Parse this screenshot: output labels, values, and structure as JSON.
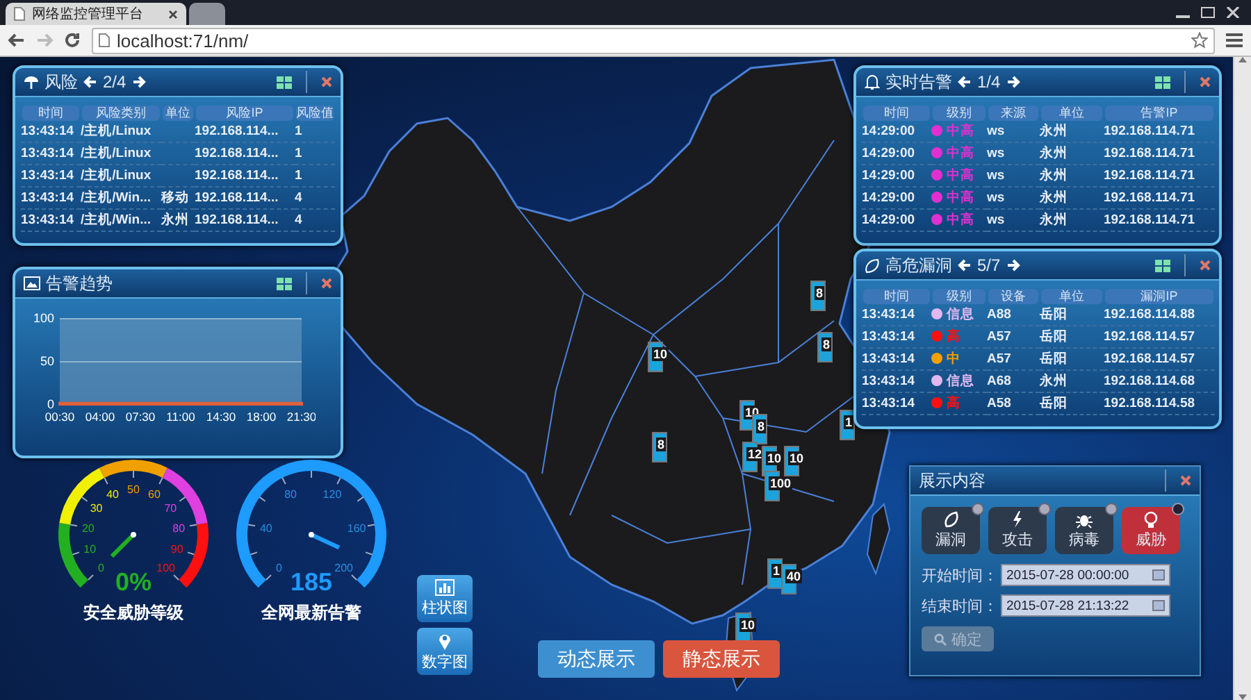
{
  "browser": {
    "tabs": [
      {
        "title": "网络监控管理平台",
        "selected": true
      },
      {
        "selected": false
      }
    ],
    "url": "localhost:71/nm/"
  },
  "risk_panel": {
    "title": "风险",
    "page": "2/4",
    "columns": [
      "时间",
      "风险类别",
      "单位",
      "风险IP",
      "风险值"
    ],
    "rows": [
      {
        "time": "13:43:14",
        "category": "/主机/Linux",
        "ip": "192.168.114...",
        "value": "1"
      },
      {
        "time": "13:43:14",
        "category": "/主机/Linux",
        "ip": "192.168.114...",
        "value": "1"
      },
      {
        "time": "13:43:14",
        "category": "/主机/Linux",
        "ip": "192.168.114...",
        "value": "1"
      },
      {
        "time": "13:43:14",
        "category": "/主机/Win...",
        "unit": "移动",
        "ip": "192.168.114...",
        "value": "4"
      },
      {
        "time": "13:43:14",
        "category": "/主机/Win...",
        "unit": "永州",
        "ip": "192.168.114...",
        "value": "4"
      }
    ]
  },
  "trend_panel": {
    "title": "告警趋势",
    "chart_data": {
      "type": "area",
      "categories": [
        "00:30",
        "04:00",
        "07:30",
        "11:00",
        "14:30",
        "18:00",
        "21:30"
      ],
      "series": [
        {
          "color": "#e0603c",
          "values": [
            1,
            1,
            1,
            1,
            1,
            1,
            1
          ]
        }
      ],
      "ylim": [
        0,
        100
      ],
      "yticks": [
        0,
        50,
        100
      ]
    }
  },
  "alert_panel": {
    "title": "实时告警",
    "page": "1/4",
    "columns": [
      "时间",
      "级别",
      "来源",
      "单位",
      "告警IP"
    ],
    "rows": [
      {
        "time": "14:29:00",
        "level": "中高",
        "color": "#e030d0",
        "source": "ws",
        "unit": "永州",
        "ip": "192.168.114.71"
      },
      {
        "time": "14:29:00",
        "level": "中高",
        "color": "#e030d0",
        "source": "ws",
        "unit": "永州",
        "ip": "192.168.114.71"
      },
      {
        "time": "14:29:00",
        "level": "中高",
        "color": "#e030d0",
        "source": "ws",
        "unit": "永州",
        "ip": "192.168.114.71"
      },
      {
        "time": "14:29:00",
        "level": "中高",
        "color": "#e030d0",
        "source": "ws",
        "unit": "永州",
        "ip": "192.168.114.71"
      },
      {
        "time": "14:29:00",
        "level": "中高",
        "color": "#e030d0",
        "source": "ws",
        "unit": "永州",
        "ip": "192.168.114.71"
      }
    ]
  },
  "vuln_panel": {
    "title": "高危漏洞",
    "page": "5/7",
    "columns": [
      "时间",
      "级别",
      "设备",
      "单位",
      "漏洞IP"
    ],
    "rows": [
      {
        "time": "13:43:14",
        "level": "信息",
        "color": "#e0b8f0",
        "device": "A88",
        "unit": "岳阳",
        "ip": "192.168.114.88"
      },
      {
        "time": "13:43:14",
        "level": "高",
        "color": "#ff1010",
        "device": "A57",
        "unit": "岳阳",
        "ip": "192.168.114.57"
      },
      {
        "time": "13:43:14",
        "level": "中",
        "color": "#f0a000",
        "device": "A57",
        "unit": "岳阳",
        "ip": "192.168.114.57"
      },
      {
        "time": "13:43:14",
        "level": "信息",
        "color": "#e0b8f0",
        "device": "A68",
        "unit": "永州",
        "ip": "192.168.114.68"
      },
      {
        "time": "13:43:14",
        "level": "高",
        "color": "#ff1010",
        "device": "A58",
        "unit": "岳阳",
        "ip": "192.168.114.58"
      }
    ]
  },
  "map_markers": [
    {
      "value": "8"
    },
    {
      "value": "10"
    },
    {
      "value": "8"
    },
    {
      "value": "1"
    },
    {
      "value": "10"
    },
    {
      "value": "8"
    },
    {
      "value": "8"
    },
    {
      "value": "12"
    },
    {
      "value": "10"
    },
    {
      "value": "10"
    },
    {
      "value": "100"
    },
    {
      "value": "1"
    },
    {
      "value": "40"
    },
    {
      "value": "10"
    }
  ],
  "gauges": [
    {
      "kind": "threat",
      "label": "安全威胁等级",
      "reading": "0%",
      "ticks": [
        "0",
        "10",
        "20",
        "30",
        "40",
        "50",
        "60",
        "70",
        "80",
        "90",
        "100"
      ]
    },
    {
      "kind": "count",
      "label": "全网最新告警",
      "reading": "185",
      "ticks": [
        "0",
        "40",
        "80",
        "120",
        "160",
        "200"
      ]
    }
  ],
  "view_buttons": [
    {
      "kind": "bar",
      "label": "柱状图"
    },
    {
      "kind": "pin",
      "label": "数字图"
    }
  ],
  "mode_buttons": [
    {
      "label": "动态展示",
      "selected": false
    },
    {
      "label": "静态展示",
      "selected": true
    }
  ],
  "display_panel": {
    "title": "展示内容",
    "filters": [
      {
        "kind": "vuln",
        "label": "漏洞",
        "selected": false
      },
      {
        "kind": "attack",
        "label": "攻击",
        "selected": false
      },
      {
        "kind": "virus",
        "label": "病毒",
        "selected": false
      },
      {
        "kind": "threat",
        "label": "威胁",
        "selected": true
      }
    ],
    "fields": [
      {
        "label": "开始时间：",
        "value": "2015-07-28 00:00:00"
      },
      {
        "label": "结束时间：",
        "value": "2015-07-28 21:13:22"
      }
    ],
    "confirm": {
      "label": "确定",
      "disabled": true
    }
  }
}
